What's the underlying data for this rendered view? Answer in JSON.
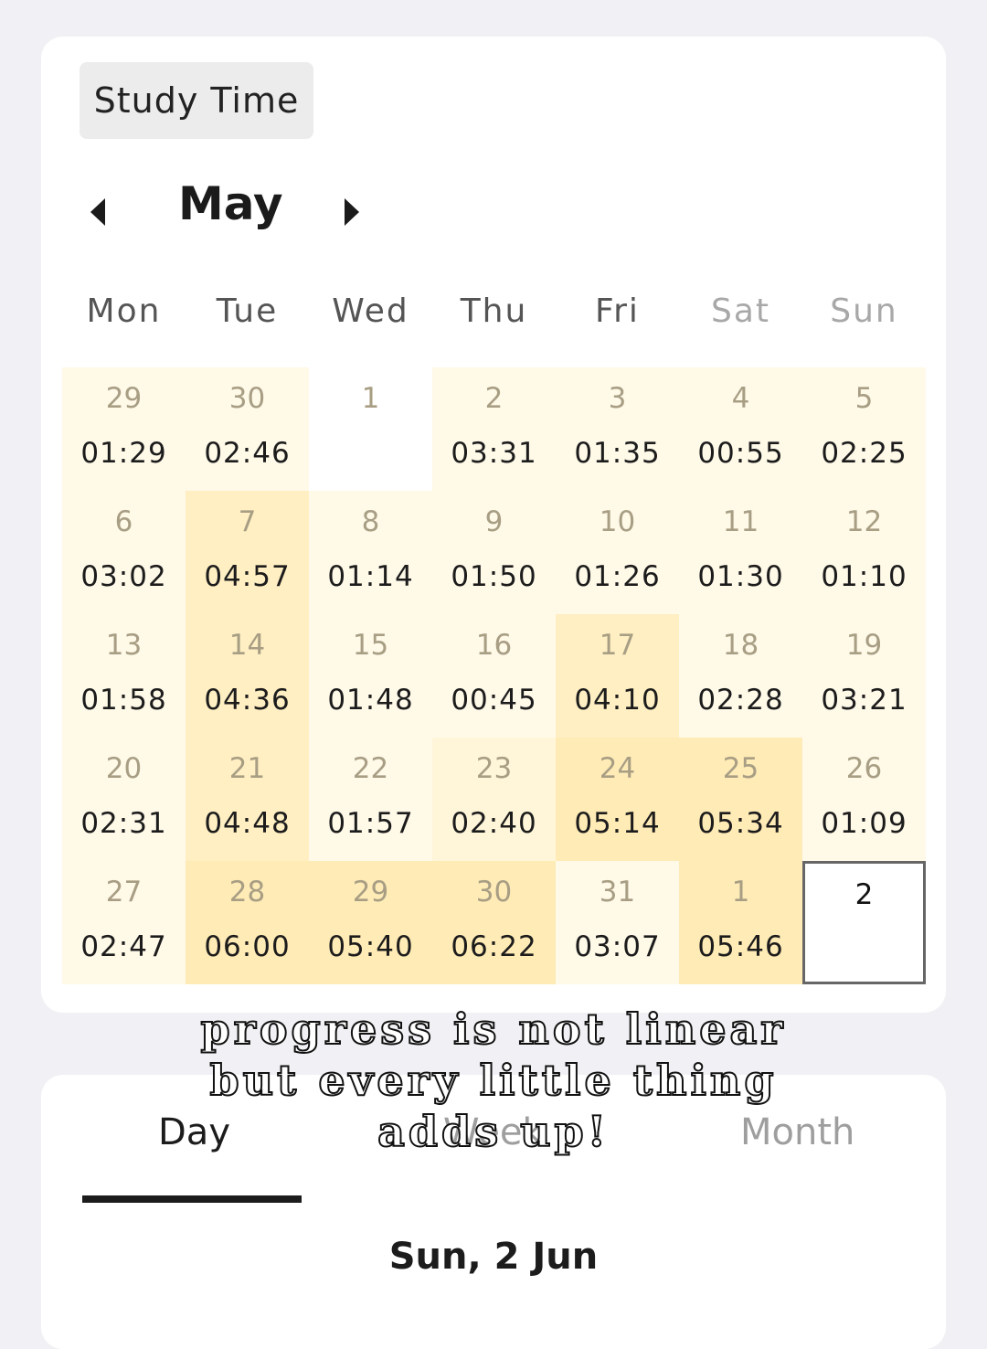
{
  "header": {
    "study_time_label": "Study Time"
  },
  "month_nav": {
    "prev_icon": "caret-left-icon",
    "next_icon": "caret-right-icon",
    "month": "May"
  },
  "weekdays": [
    "Mon",
    "Tue",
    "Wed",
    "Thu",
    "Fri",
    "Sat",
    "Sun"
  ],
  "heat_colors": {
    "none": "#ffffff",
    "low": "#fff9e8",
    "mid": "#fff6d9",
    "high": "#ffefc3",
    "max": "#ffebb6"
  },
  "calendar": {
    "weeks": [
      [
        {
          "day": "29",
          "time": "01:29",
          "level": 1
        },
        {
          "day": "30",
          "time": "02:46",
          "level": 1
        },
        {
          "day": "1",
          "time": "",
          "level": 0
        },
        {
          "day": "2",
          "time": "03:31",
          "level": 1
        },
        {
          "day": "3",
          "time": "01:35",
          "level": 1
        },
        {
          "day": "4",
          "time": "00:55",
          "level": 1
        },
        {
          "day": "5",
          "time": "02:25",
          "level": 1
        }
      ],
      [
        {
          "day": "6",
          "time": "03:02",
          "level": 1
        },
        {
          "day": "7",
          "time": "04:57",
          "level": 3
        },
        {
          "day": "8",
          "time": "01:14",
          "level": 1
        },
        {
          "day": "9",
          "time": "01:50",
          "level": 1
        },
        {
          "day": "10",
          "time": "01:26",
          "level": 1
        },
        {
          "day": "11",
          "time": "01:30",
          "level": 1
        },
        {
          "day": "12",
          "time": "01:10",
          "level": 1
        }
      ],
      [
        {
          "day": "13",
          "time": "01:58",
          "level": 1
        },
        {
          "day": "14",
          "time": "04:36",
          "level": 3
        },
        {
          "day": "15",
          "time": "01:48",
          "level": 1
        },
        {
          "day": "16",
          "time": "00:45",
          "level": 1
        },
        {
          "day": "17",
          "time": "04:10",
          "level": 3
        },
        {
          "day": "18",
          "time": "02:28",
          "level": 1
        },
        {
          "day": "19",
          "time": "03:21",
          "level": 1
        }
      ],
      [
        {
          "day": "20",
          "time": "02:31",
          "level": 1
        },
        {
          "day": "21",
          "time": "04:48",
          "level": 3
        },
        {
          "day": "22",
          "time": "01:57",
          "level": 1
        },
        {
          "day": "23",
          "time": "02:40",
          "level": 2
        },
        {
          "day": "24",
          "time": "05:14",
          "level": 4
        },
        {
          "day": "25",
          "time": "05:34",
          "level": 4
        },
        {
          "day": "26",
          "time": "01:09",
          "level": 1
        }
      ],
      [
        {
          "day": "27",
          "time": "02:47",
          "level": 1
        },
        {
          "day": "28",
          "time": "06:00",
          "level": 4
        },
        {
          "day": "29",
          "time": "05:40",
          "level": 4
        },
        {
          "day": "30",
          "time": "06:22",
          "level": 4
        },
        {
          "day": "31",
          "time": "03:07",
          "level": 1
        },
        {
          "day": "1",
          "time": "05:46",
          "level": 4
        },
        {
          "day": "2",
          "time": "",
          "level": 0,
          "today": true
        }
      ]
    ]
  },
  "overlay_text": [
    "progress is not linear",
    "but every little thing",
    "adds up!"
  ],
  "tabs": {
    "day": "Day",
    "week": "Week",
    "month": "Month"
  },
  "selected_date": "Sun, 2 Jun"
}
